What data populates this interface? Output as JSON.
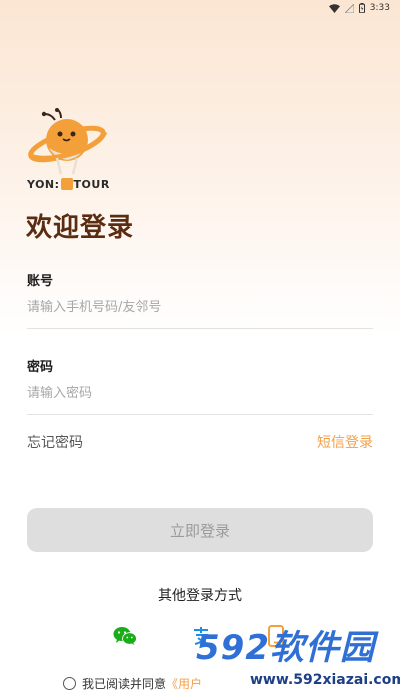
{
  "status_bar": {
    "time": "3:33"
  },
  "brand": {
    "logo_text_left": "YON",
    "logo_text_right": "TOUR"
  },
  "welcome_title": "欢迎登录",
  "account": {
    "label": "账号",
    "placeholder": "请输入手机号码/友邻号",
    "value": ""
  },
  "password": {
    "label": "密码",
    "placeholder": "请输入密码",
    "value": ""
  },
  "links": {
    "forgot_password": "忘记密码",
    "sms_login": "短信登录"
  },
  "login_button": "立即登录",
  "other_login": {
    "title": "其他登录方式",
    "methods": [
      "wechat-icon",
      "alipay-icon",
      "phone-icon"
    ]
  },
  "agreement": {
    "text": "我已阅读并同意",
    "link": "《用户"
  },
  "watermark": {
    "main": "592软件园",
    "url": "www.592xiazai.com"
  },
  "colors": {
    "accent": "#f3a04a",
    "title_brown": "#5a2c12",
    "button_disabled": "#dedede",
    "wechat_green": "#1aad19"
  }
}
